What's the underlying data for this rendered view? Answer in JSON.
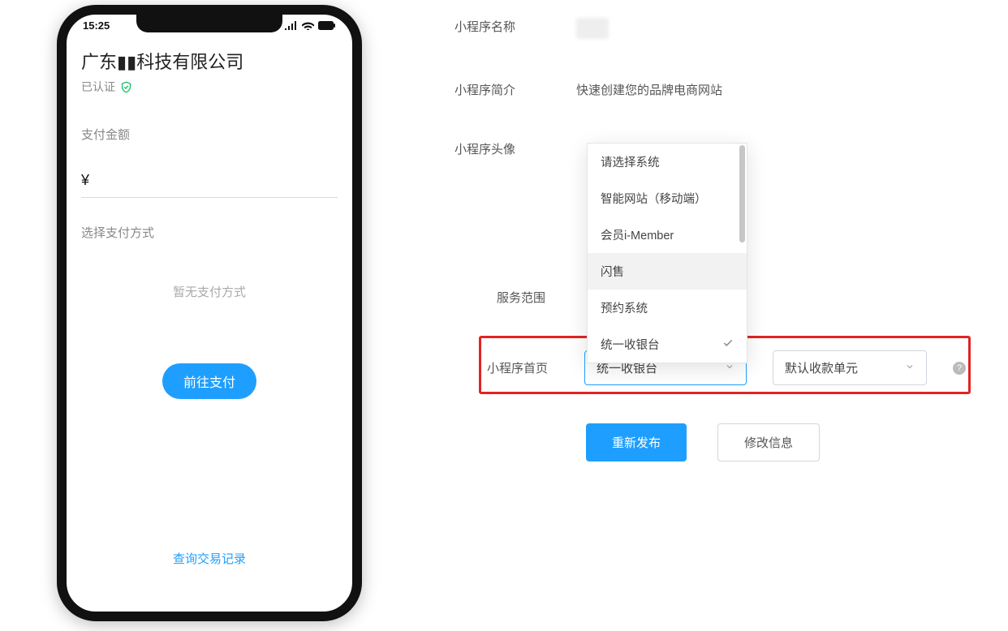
{
  "phone": {
    "time": "15:25",
    "company_name": "广东▮▮科技有限公司",
    "verified_label": "已认证",
    "amount_label": "支付金额",
    "currency_symbol": "¥",
    "method_label": "选择支付方式",
    "no_method_text": "暂无支付方式",
    "pay_button": "前往支付",
    "query_link": "查询交易记录"
  },
  "form": {
    "name_label": "小程序名称",
    "name_value": "",
    "intro_label": "小程序简介",
    "intro_value": "快速创建您的品牌电商网站",
    "avatar_label": "小程序头像",
    "scope_label": "服务范围",
    "homepage_label": "小程序首页",
    "select_system": "统一收银台",
    "select_unit": "默认收款单元",
    "republish_btn": "重新发布",
    "edit_btn": "修改信息"
  },
  "dropdown": {
    "placeholder": "请选择系统",
    "items": [
      {
        "label": "智能网站（移动端）",
        "selected": false
      },
      {
        "label": "会员i-Member",
        "selected": false
      },
      {
        "label": "闪售",
        "selected": false,
        "hover": true
      },
      {
        "label": "预约系统",
        "selected": false
      },
      {
        "label": "统一收银台",
        "selected": true
      }
    ]
  }
}
